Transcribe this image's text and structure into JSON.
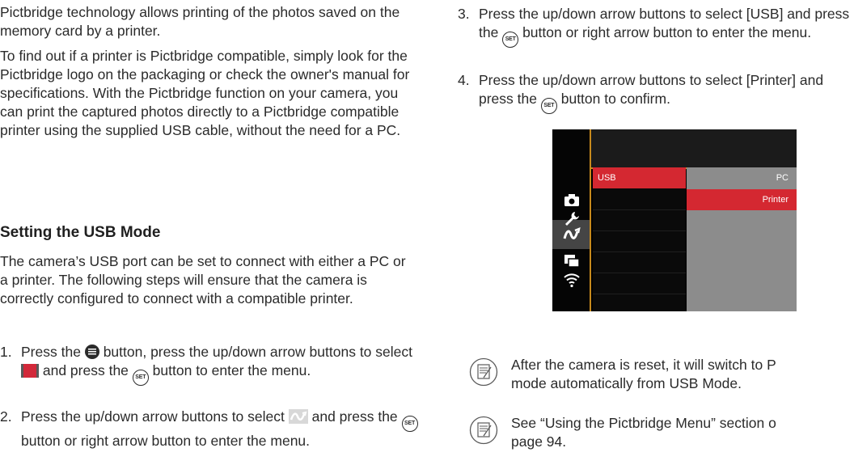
{
  "left": {
    "intro_p1": "Pictbridge technology allows printing of the photos saved on the memory card by a printer.",
    "intro_p2": "To find out if a printer is Pictbridge compatible, simply look for the Pictbridge logo on the packaging or check the owner's manual for specifications. With the Pictbridge function on your camera, you can print the captured photos directly to a Pictbridge compatible printer using the supplied USB cable, without the need for a PC.",
    "heading": "Setting the USB Mode",
    "section_p": "The camera’s USB port can be set to connect with either a PC or a printer. The following steps will ensure that the camera is correctly configured to connect with a compatible printer.",
    "steps": [
      {
        "num": "1.",
        "a": "Press the",
        "b": "button, press the up/down arrow buttons to select",
        "c": "and press the",
        "d": "button to enter the menu."
      },
      {
        "num": "2.",
        "a": "Press the up/down arrow buttons to select",
        "b": "and press the",
        "c": "button or right arrow button to enter the menu."
      }
    ]
  },
  "right": {
    "steps": [
      {
        "num": "3.",
        "a": "Press the up/down arrow buttons to select [USB] and press the",
        "b": "button or right arrow button to enter the menu."
      },
      {
        "num": "4.",
        "a": "Press the up/down arrow buttons to select [Printer] and press the",
        "b": "button to confirm."
      }
    ],
    "screen": {
      "menu_item": "USB",
      "options": [
        "PC",
        "Printer"
      ],
      "selected_option": "Printer",
      "accent_color": "#d42831",
      "divider_color": "#c78a1d"
    },
    "notes": [
      {
        "line1": "After the camera is reset, it will switch to P",
        "line2": "mode automatically from USB Mode."
      },
      {
        "line1": "See “Using the Pictbridge Menu” section o",
        "line2": "page 94."
      }
    ]
  },
  "icons": {
    "set_button": "SET",
    "set_icon": "set-button-icon",
    "menu_icon": "menu-button-icon",
    "film_icon": "setting-menu-icon",
    "connection_icon": "connection-icon",
    "note_icon": "note-icon"
  }
}
